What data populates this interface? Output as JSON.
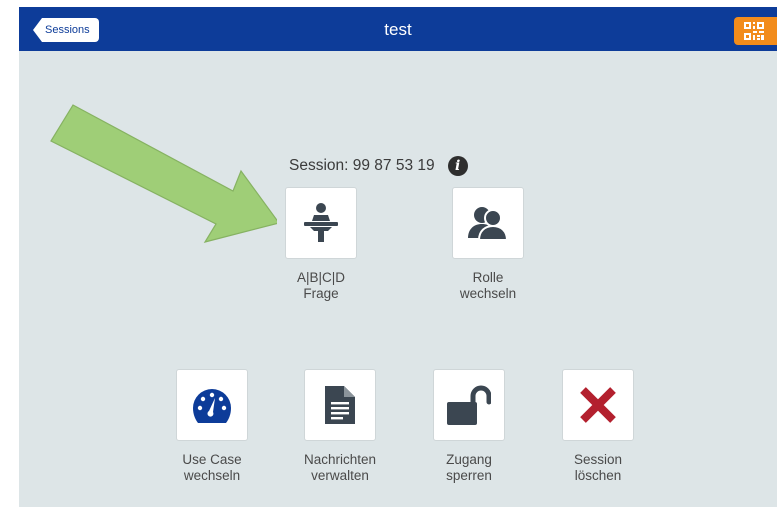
{
  "header": {
    "back_label": "Sessions",
    "title": "test"
  },
  "session": {
    "label": "Session: 99 87 53 19"
  },
  "tiles": [
    {
      "line1": "A|B|C|D",
      "line2": "Frage"
    },
    {
      "line1": "Rolle",
      "line2": "wechseln"
    },
    {
      "line1": "Use Case",
      "line2": "wechseln"
    },
    {
      "line1": "Nachrichten",
      "line2": "verwalten"
    },
    {
      "line1": "Zugang",
      "line2": "sperren"
    },
    {
      "line1": "Session",
      "line2": "löschen"
    }
  ],
  "colors": {
    "header_bg": "#0d3c99",
    "background": "#dde5e7",
    "qr_button": "#f28c1c",
    "arrow": "#9acd6e",
    "delete_icon": "#b3202e",
    "icon_dark": "#3b4651"
  },
  "icons": [
    "back-chevron",
    "qr-code-icon",
    "info-icon",
    "lectern-icon",
    "users-icon",
    "speedometer-icon",
    "document-icon",
    "unlock-icon",
    "x-icon"
  ]
}
